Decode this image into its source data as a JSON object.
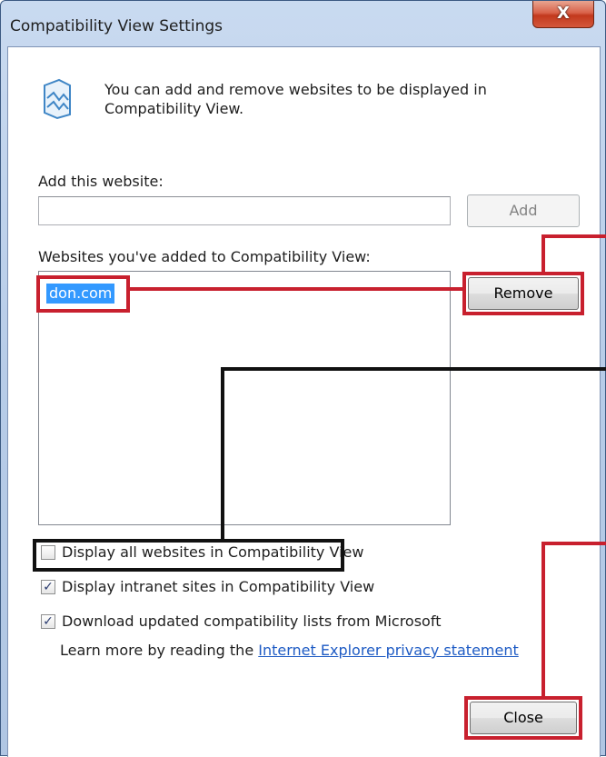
{
  "window": {
    "title": "Compatibility View Settings",
    "close_glyph": "X"
  },
  "intro": {
    "icon": "compatibility-view-icon",
    "text": "You can add and remove websites to be displayed in Compatibility View."
  },
  "add_section": {
    "label": "Add this website:",
    "input_value": "",
    "add_button": "Add"
  },
  "list_section": {
    "label": "Websites you've added to Compatibility View:",
    "items": [
      "don.com"
    ],
    "selected_index": 0,
    "remove_button": "Remove"
  },
  "options": [
    {
      "label": "Display all websites in Compatibility View",
      "checked": false
    },
    {
      "label": "Display intranet sites in Compatibility View",
      "checked": true
    },
    {
      "label": "Download updated compatibility lists from Microsoft",
      "checked": true
    }
  ],
  "privacy": {
    "prefix": "Learn more by reading the ",
    "link_text": "Internet Explorer privacy statement"
  },
  "footer": {
    "close_button": "Close"
  },
  "colors": {
    "annotation_red": "#c8202e",
    "annotation_black": "#111111",
    "selection_blue": "#3399ff",
    "link_blue": "#1e5bc4"
  }
}
